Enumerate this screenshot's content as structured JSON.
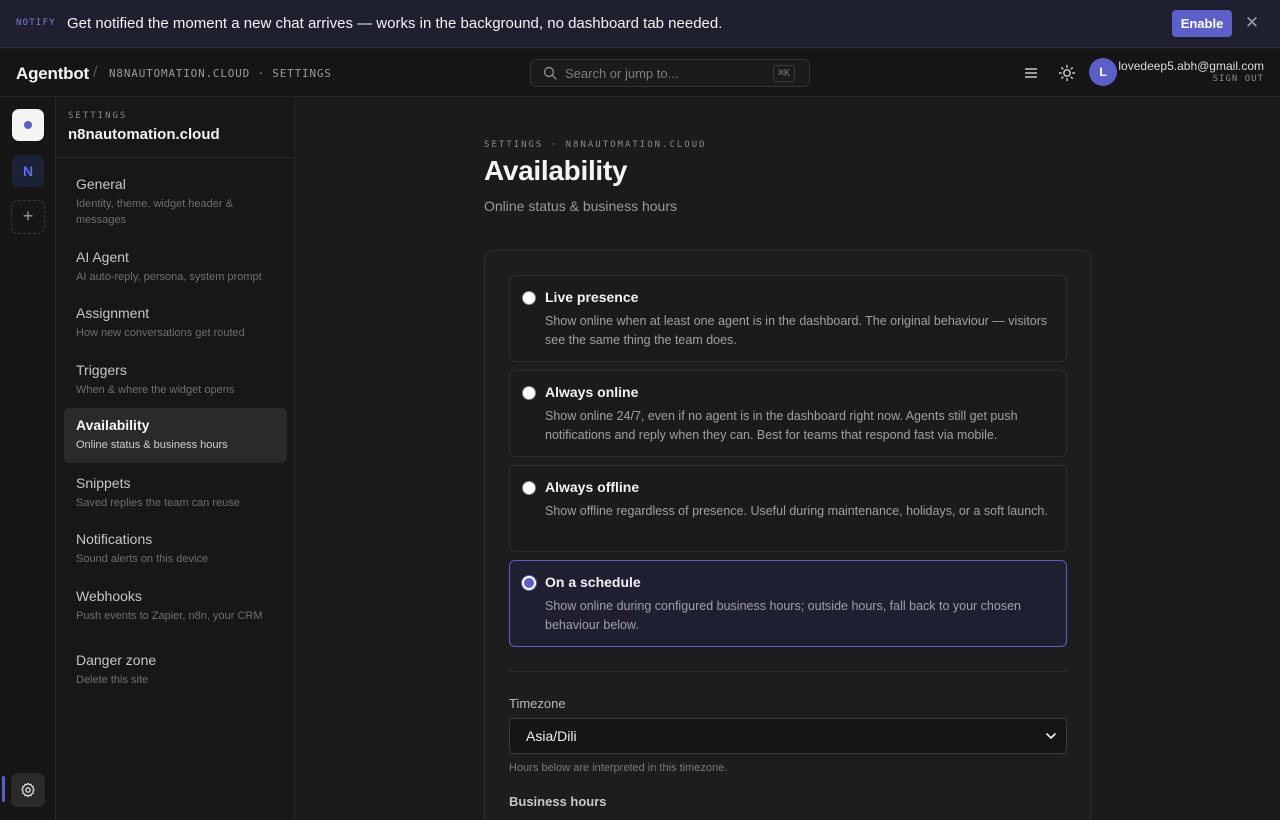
{
  "banner": {
    "tag": "NOTIFY",
    "message": "Get notified the moment a new chat arrives — works in the background, no dashboard tab needed.",
    "enable_label": "Enable",
    "close_glyph": "✕"
  },
  "topbar": {
    "brand": "Agentbot",
    "separator": "/",
    "crumb": "N8NAUTOMATION.CLOUD · SETTINGS",
    "search_placeholder": "Search or jump to...",
    "search_shortcut": "⌘K",
    "avatar_initial": "L",
    "email": "lovedeep5.abh@gmail.com",
    "sign_out": "SIGN OUT"
  },
  "rail": {
    "site_initial": "N",
    "add_glyph": "+"
  },
  "settings_nav": {
    "kicker": "SETTINGS",
    "site_name": "n8nautomation.cloud",
    "items": [
      {
        "title": "General",
        "desc": "Identity, theme, widget header & messages"
      },
      {
        "title": "AI Agent",
        "desc": "AI auto-reply, persona, system prompt"
      },
      {
        "title": "Assignment",
        "desc": "How new conversations get routed"
      },
      {
        "title": "Triggers",
        "desc": "When & where the widget opens"
      },
      {
        "title": "Availability",
        "desc": "Online status & business hours"
      },
      {
        "title": "Snippets",
        "desc": "Saved replies the team can reuse"
      },
      {
        "title": "Notifications",
        "desc": "Sound alerts on this device"
      },
      {
        "title": "Webhooks",
        "desc": "Push events to Zapier, n8n, your CRM"
      },
      {
        "title": "Danger zone",
        "desc": "Delete this site"
      }
    ]
  },
  "main": {
    "kicker": "SETTINGS · N8NAUTOMATION.CLOUD",
    "title": "Availability",
    "subtitle": "Online status & business hours",
    "options": [
      {
        "title": "Live presence",
        "desc": "Show online when at least one agent is in the dashboard. The original behaviour — visitors see the same thing the team does."
      },
      {
        "title": "Always online",
        "desc": "Show online 24/7, even if no agent is in the dashboard right now. Agents still get push notifications and reply when they can. Best for teams that respond fast via mobile."
      },
      {
        "title": "Always offline",
        "desc": "Show offline regardless of presence. Useful during maintenance, holidays, or a soft launch."
      },
      {
        "title": "On a schedule",
        "desc": "Show online during configured business hours; outside hours, fall back to your chosen behaviour below."
      }
    ],
    "selected_option": "On a schedule",
    "timezone_label": "Timezone",
    "timezone_value": "Asia/Dili",
    "timezone_hint": "Hours below are interpreted in this timezone.",
    "business_hours_label": "Business hours"
  },
  "colors": {
    "accent": "#5b5fc7",
    "background": "#1b1b1b",
    "banner_bg": "#1e2030"
  }
}
